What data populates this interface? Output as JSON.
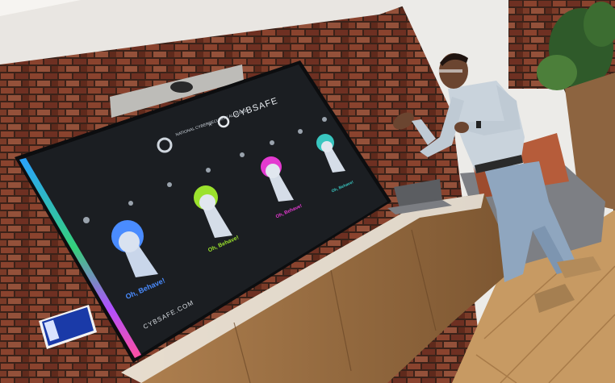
{
  "presentation": {
    "header_org": "NATIONAL CYBERSECURITY ALLIANCE",
    "header_separator": "×",
    "header_brand": "CYBSAFE",
    "footer_url": "CYBSAFE.COM",
    "slide_title": "Oh, Behave!",
    "keyhole_colors": [
      "#4a8cff",
      "#9be22d",
      "#e43ad0",
      "#39c6c0"
    ]
  },
  "colors": {
    "brick": "#7a3a28",
    "screen": "#1b1e22",
    "wood": "#9b6f45",
    "floor": "#c79a63",
    "shirt": "#c9d3dc",
    "jeans": "#8fa6bf"
  }
}
